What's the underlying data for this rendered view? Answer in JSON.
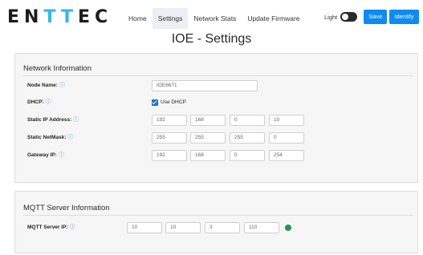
{
  "header": {
    "logo_prefix": "EN",
    "logo_accent": "TT",
    "logo_suffix": "EC",
    "nav": [
      "Home",
      "Settings",
      "Network Stats",
      "Update Firmware"
    ],
    "active_nav": "Settings",
    "theme_label": "Light",
    "save_label": "Save",
    "identify_label": "Identify"
  },
  "page_title": "IOE - Settings",
  "network": {
    "title": "Network Information",
    "info_icon": "info-icon",
    "node_name_label": "Node Name:",
    "node_name_value": "IOE6671",
    "dhcp_label": "DHCP:",
    "dhcp_checked": true,
    "dhcp_option_label": "Use DHCP",
    "static_ip_label": "Static IP Address:",
    "static_ip": [
      "192",
      "168",
      "0",
      "10"
    ],
    "netmask_label": "Static NetMask:",
    "netmask": [
      "255",
      "255",
      "255",
      "0"
    ],
    "gateway_label": "Gateway IP:",
    "gateway": [
      "192",
      "168",
      "0",
      "254"
    ]
  },
  "mqtt": {
    "title": "MQTT Server Information",
    "server_ip_label": "MQTT Server IP:",
    "server_ip": [
      "10",
      "10",
      "3",
      "110"
    ],
    "status_color": "#1e9a50"
  },
  "colors": {
    "accent": "#33b8e6",
    "button": "#0d8bf2"
  }
}
